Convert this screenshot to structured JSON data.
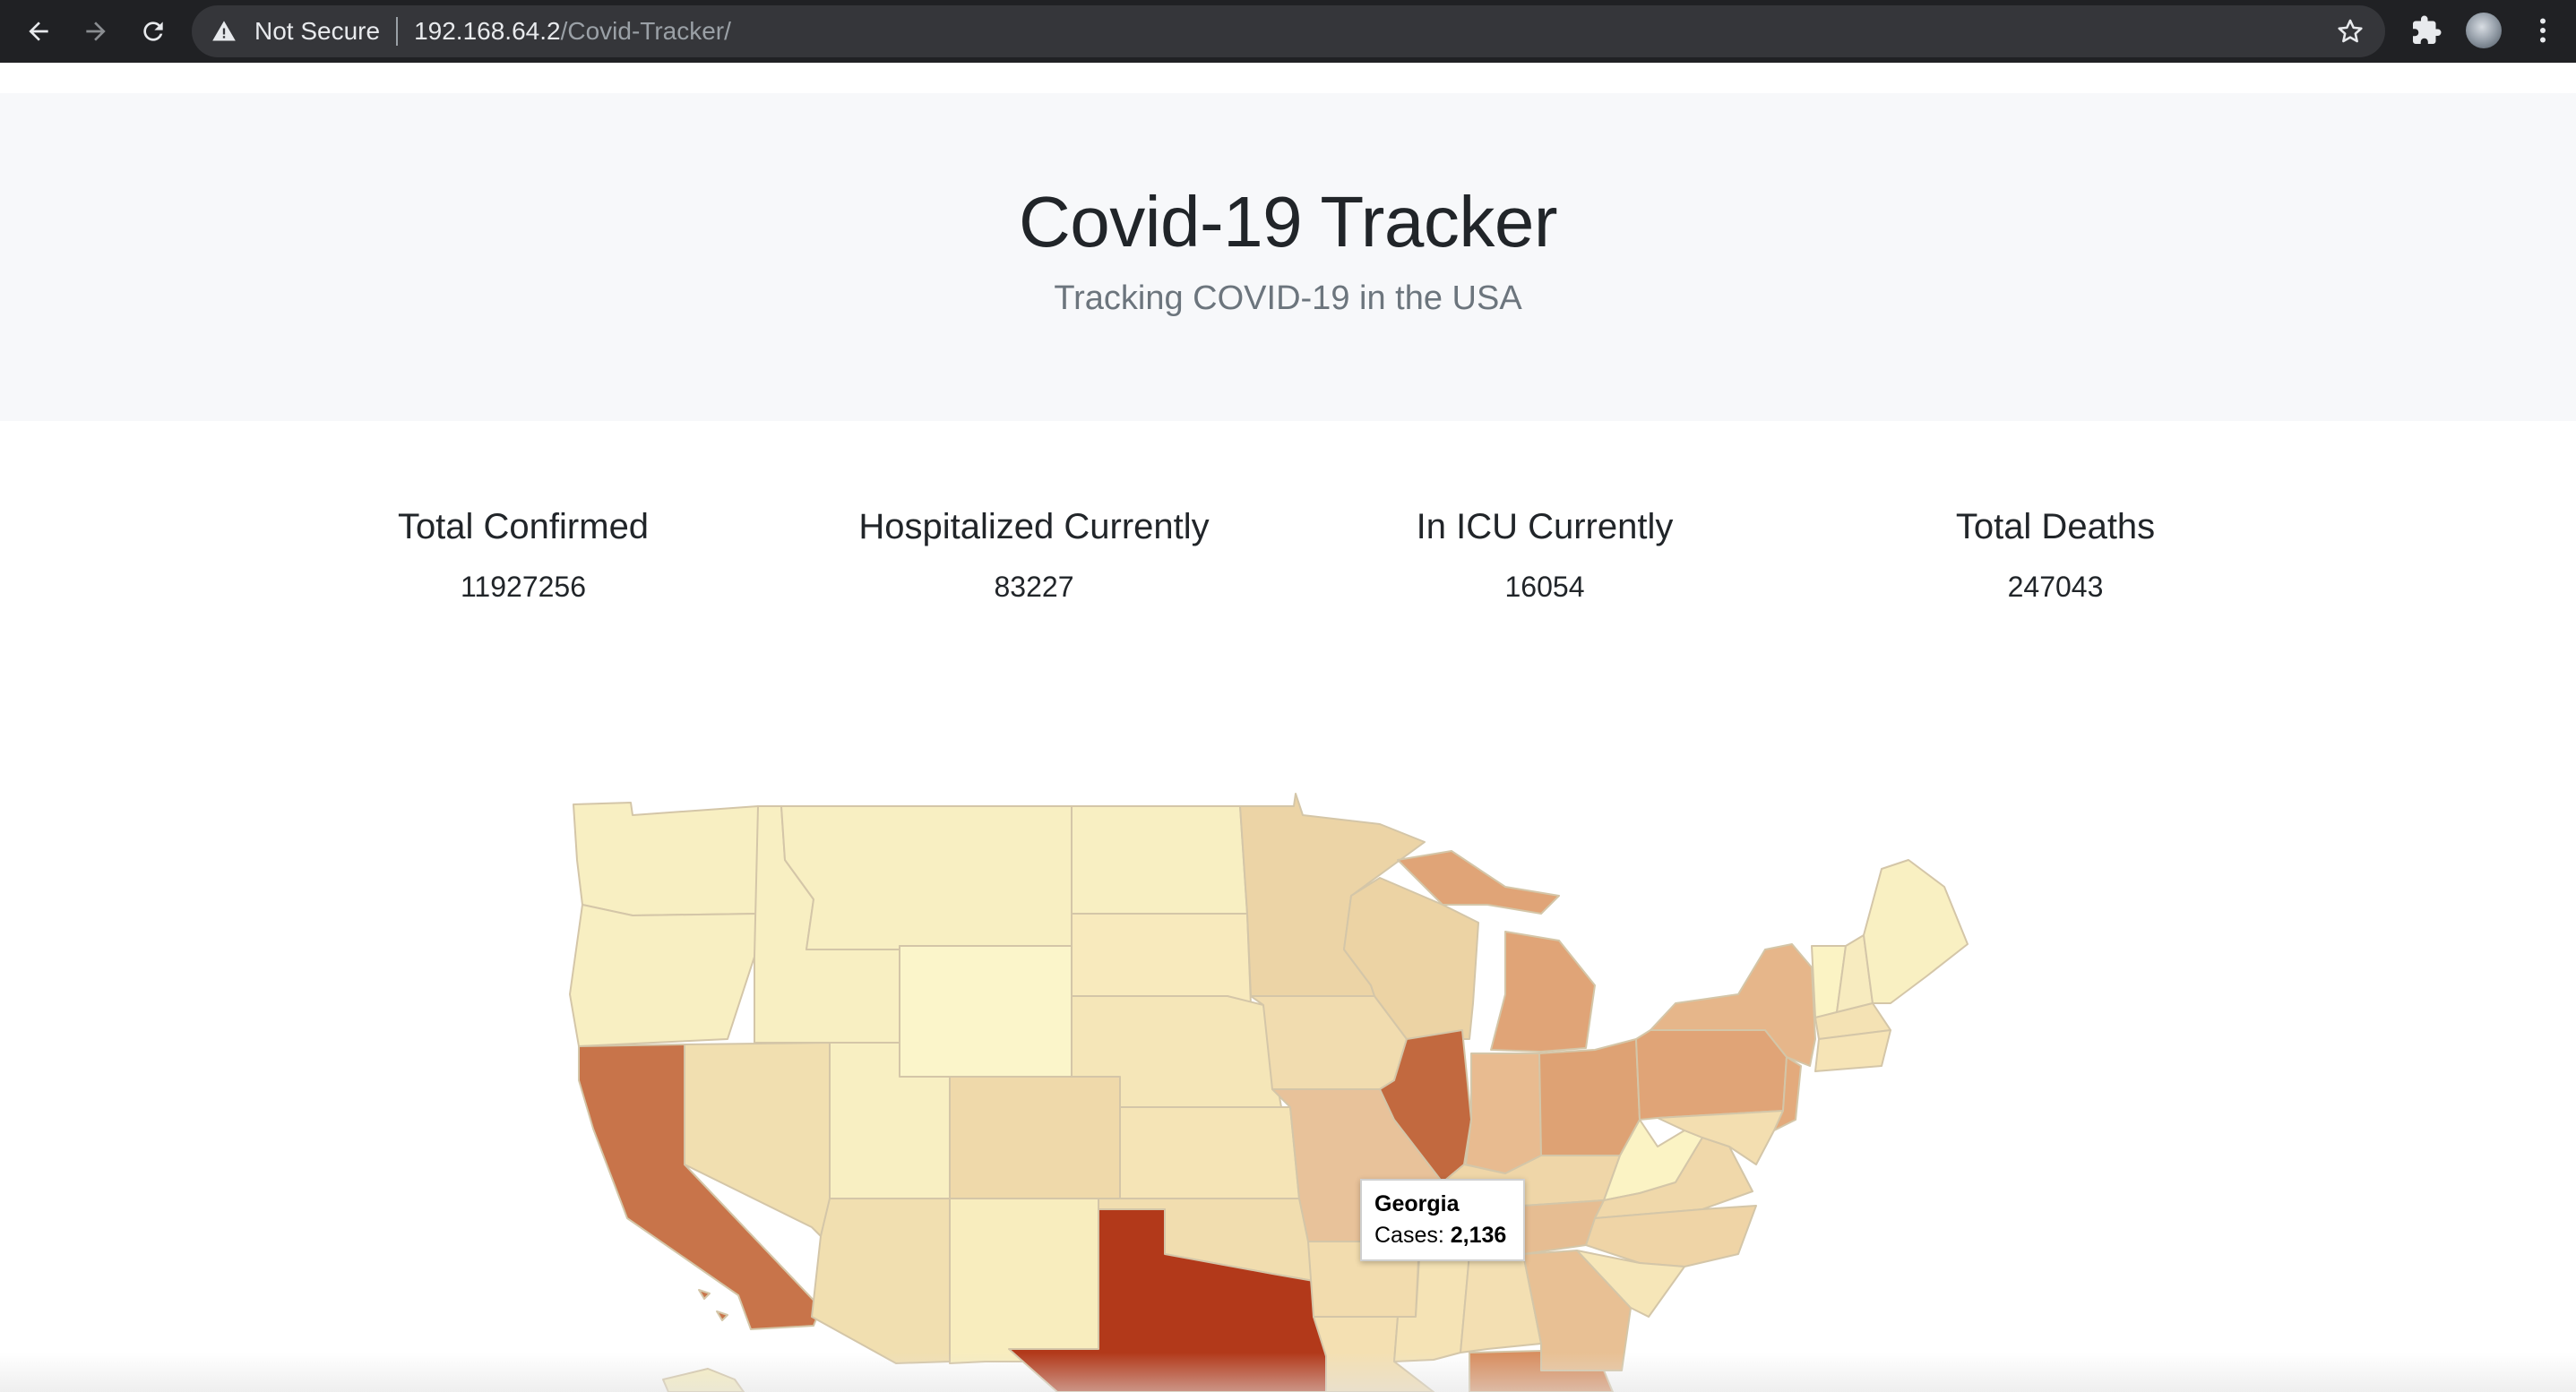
{
  "browser": {
    "security_label": "Not Secure",
    "url_host": "192.168.64.2",
    "url_path": "/Covid-Tracker/"
  },
  "header": {
    "title": "Covid-19 Tracker",
    "subtitle": "Tracking COVID-19 in the USA"
  },
  "stats": [
    {
      "label": "Total Confirmed",
      "value": "11927256"
    },
    {
      "label": "Hospitalized Currently",
      "value": "83227"
    },
    {
      "label": "In ICU Currently",
      "value": "16054"
    },
    {
      "label": "Total Deaths",
      "value": "247043"
    }
  ],
  "map": {
    "color_scale": {
      "low": "#fbf3c4",
      "mid": "#e0a477",
      "high": "#b2391a"
    },
    "tooltip": {
      "state": "Georgia",
      "cases_label": "Cases:",
      "cases_value": "2,136"
    }
  }
}
